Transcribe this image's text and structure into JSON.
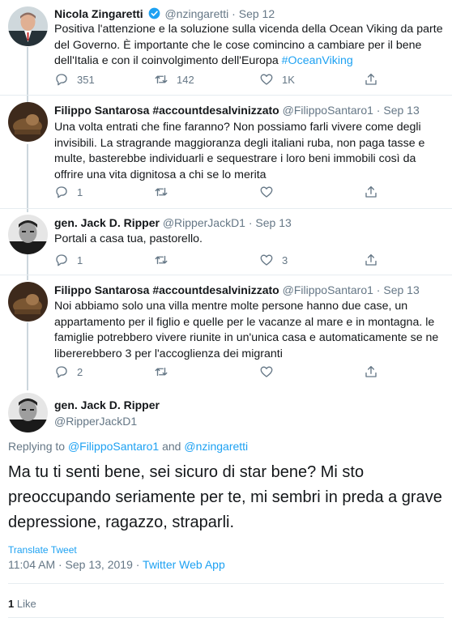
{
  "tweets": [
    {
      "name": "Nicola Zingaretti",
      "verified": true,
      "handle": "@nzingaretti",
      "date": "Sep 12",
      "text": "Positiva l'attenzione e la soluzione sulla vicenda della Ocean Viking da parte del Governo. È importante che le cose comincino a cambiare per il bene dell'Italia e con il coinvolgimento dell'Europa ",
      "hashtag": "#OceanViking",
      "replies": "351",
      "retweets": "142",
      "likes": "1K"
    },
    {
      "name": "Filippo Santarosa #accountdesalvinizzato",
      "handle": "@FilippoSantaro1",
      "date": "Sep 13",
      "text": "Una volta entrati che fine faranno? Non possiamo farli vivere come degli invisibili. La stragrande maggioranza degli italiani ruba, non paga tasse e multe, basterebbe individuarli e sequestrare i loro beni immobili così da offrire una vita dignitosa a chi se lo merita",
      "replies": "1",
      "retweets": "",
      "likes": ""
    },
    {
      "name": "gen. Jack D. Ripper",
      "handle": "@RipperJackD1",
      "date": "Sep 13",
      "text": "Portali a casa tua, pastorello.",
      "replies": "1",
      "retweets": "",
      "likes": "3"
    },
    {
      "name": "Filippo Santarosa #accountdesalvinizzato",
      "handle": "@FilippoSantaro1",
      "date": "Sep 13",
      "text": "Noi abbiamo solo una villa mentre molte persone hanno due case, un appartamento per il figlio e quelle per le vacanze al mare e in montagna. le famiglie potrebbero vivere riunite in un'unica casa e automaticamente se ne libererebbero 3 per l'accoglienza dei migranti",
      "replies": "2",
      "retweets": "",
      "likes": ""
    }
  ],
  "main_tweet": {
    "name": "gen. Jack D. Ripper",
    "handle": "@RipperJackD1",
    "replying_prefix": "Replying to ",
    "replying_user1": "@FilippoSantaro1",
    "replying_and": " and ",
    "replying_user2": "@nzingaretti",
    "text": "Ma tu ti senti bene, sei sicuro di star bene? Mi sto preoccupando seriamente per te, mi sembri in preda a grave depressione, ragazzo, straparli.",
    "translate": "Translate Tweet",
    "time": "11:04 AM · Sep 13, 2019 · ",
    "source": "Twitter Web App",
    "like_count": "1",
    "like_label": " Like"
  },
  "separator": " · ",
  "colors": {
    "link": "#1da1f2",
    "muted": "#657786",
    "text": "#14171a",
    "divider": "#e6ecf0"
  },
  "icons": [
    "reply-icon",
    "retweet-icon",
    "like-icon",
    "share-icon",
    "verified-badge-icon"
  ]
}
